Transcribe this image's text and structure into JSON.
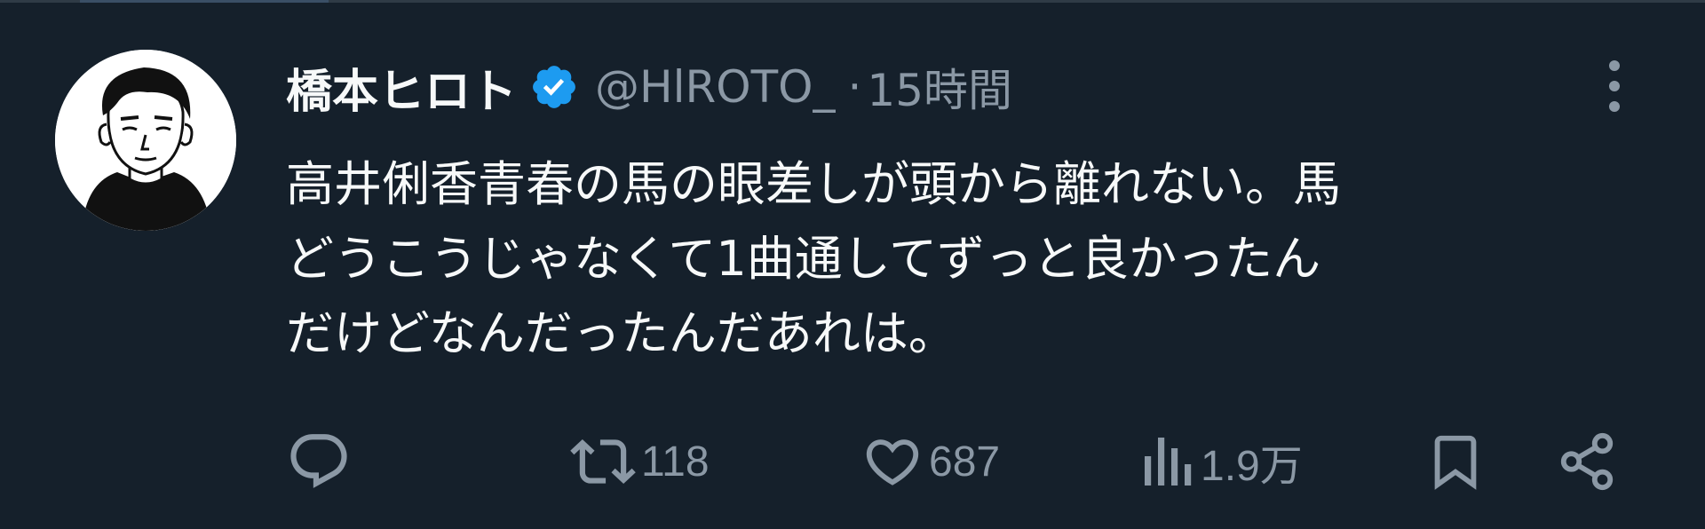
{
  "tweet": {
    "display_name": "橋本ヒロト",
    "verified_icon": "verified-badge-icon",
    "handle": "@HlROTO_",
    "separator": "·",
    "time": "15時間",
    "text_lines": [
      "高井俐香青春の馬の眼差しが頭から離れない。馬",
      "どうこうじゃなくて1曲通してずっと良かったん",
      "だけどなんだったんだあれは。"
    ]
  },
  "actions": {
    "reply": {
      "icon": "reply-icon"
    },
    "retweet": {
      "icon": "retweet-icon",
      "count": "118"
    },
    "like": {
      "icon": "heart-icon",
      "count": "687"
    },
    "views": {
      "icon": "views-icon",
      "count": "1.9万"
    },
    "bookmark": {
      "icon": "bookmark-icon"
    },
    "share": {
      "icon": "share-icon"
    }
  },
  "colors": {
    "background": "#15202b",
    "text_primary": "#f7f9f9",
    "text_secondary": "#8b98a5",
    "verified": "#1d9bf0"
  }
}
